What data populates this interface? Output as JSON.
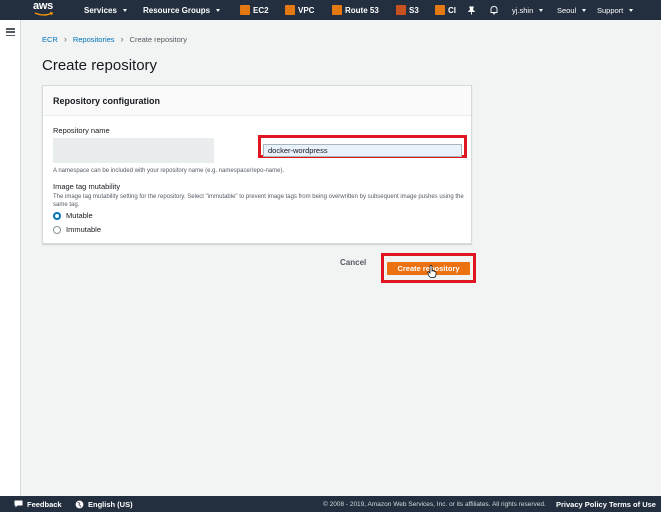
{
  "topnav": {
    "logo": "aws",
    "services": "Services",
    "resource_groups": "Resource Groups",
    "shortcuts": [
      {
        "label": "EC2",
        "icon": "ec2-icon"
      },
      {
        "label": "VPC",
        "icon": "vpc-icon"
      },
      {
        "label": "Route 53",
        "icon": "route53-icon"
      },
      {
        "label": "S3",
        "icon": "s3-icon"
      },
      {
        "label": "CI",
        "icon": "ci-icon"
      }
    ],
    "user": "yj.shin",
    "region": "Seoul",
    "support": "Support"
  },
  "breadcrumb": {
    "items": [
      "ECR",
      "Repositories"
    ],
    "current": "Create repository"
  },
  "page": {
    "title": "Create repository"
  },
  "panel": {
    "title": "Repository configuration",
    "repo_name_label": "Repository name",
    "repo_name_value": "docker-wordpress",
    "repo_name_hint": "A namespace can be included with your repository name (e.g. namespace/repo-name).",
    "mutability_label": "Image tag mutability",
    "mutability_desc": "The image tag mutability setting for the repository. Select \"immutable\" to prevent image tags from being overwritten by subsequent image pushes using the same tag.",
    "options": [
      "Mutable",
      "Immutable"
    ],
    "selected": "Mutable"
  },
  "actions": {
    "cancel": "Cancel",
    "create": "Create repository"
  },
  "footer": {
    "feedback": "Feedback",
    "language": "English (US)",
    "copyright": "© 2008 - 2019, Amazon Web Services, Inc. or its affiliates. All rights reserved.",
    "privacy": "Privacy Policy",
    "terms": "Terms of Use"
  },
  "colors": {
    "nav_bg": "#232f3e",
    "primary_button": "#ec7211",
    "highlight": "#e0161f",
    "link": "#0073bb"
  }
}
